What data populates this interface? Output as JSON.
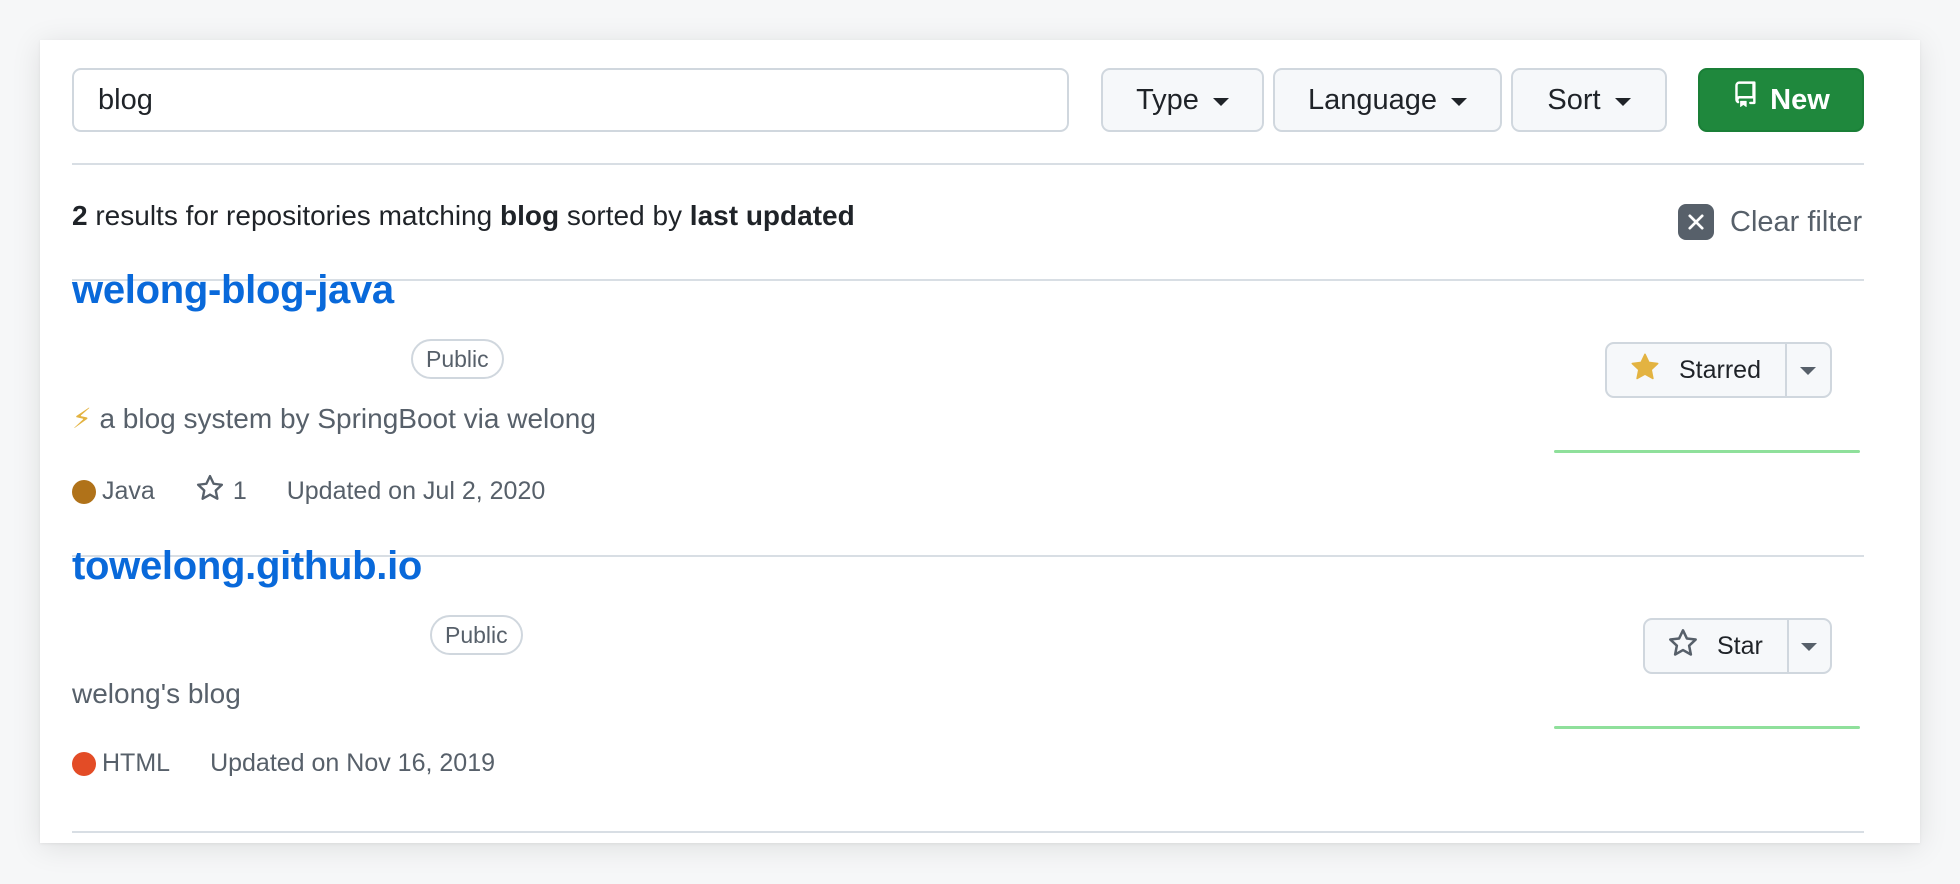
{
  "search": {
    "value": "blog"
  },
  "toolbar": {
    "type_label": "Type",
    "language_label": "Language",
    "sort_label": "Sort",
    "new_label": "New"
  },
  "results": {
    "count": "2",
    "text_results_for": " results for repositories matching ",
    "query": "blog",
    "text_sorted_by": " sorted by ",
    "sort_order": "last updated",
    "clear_filter_label": "Clear filter"
  },
  "repos": [
    {
      "name": "welong-blog-java",
      "visibility": "Public",
      "description_emoji": "⚡",
      "description": "a blog system by SpringBoot via welong",
      "language": "Java",
      "language_color": "#b07219",
      "stars": "1",
      "updated": "Updated on Jul 2, 2020",
      "star_button_label": "Starred",
      "starred": true,
      "star_icon": "star-fill-icon"
    },
    {
      "name": "towelong.github.io",
      "visibility": "Public",
      "description": "welong's blog",
      "language": "HTML",
      "language_color": "#e34c26",
      "updated": "Updated on Nov 16, 2019",
      "star_button_label": "Star",
      "starred": false,
      "star_icon": "star-icon"
    }
  ],
  "colors": {
    "link": "#0969da",
    "primary_button": "#1f883d",
    "sparkline": "#8fe09b",
    "star_fill": "#e3b341"
  }
}
